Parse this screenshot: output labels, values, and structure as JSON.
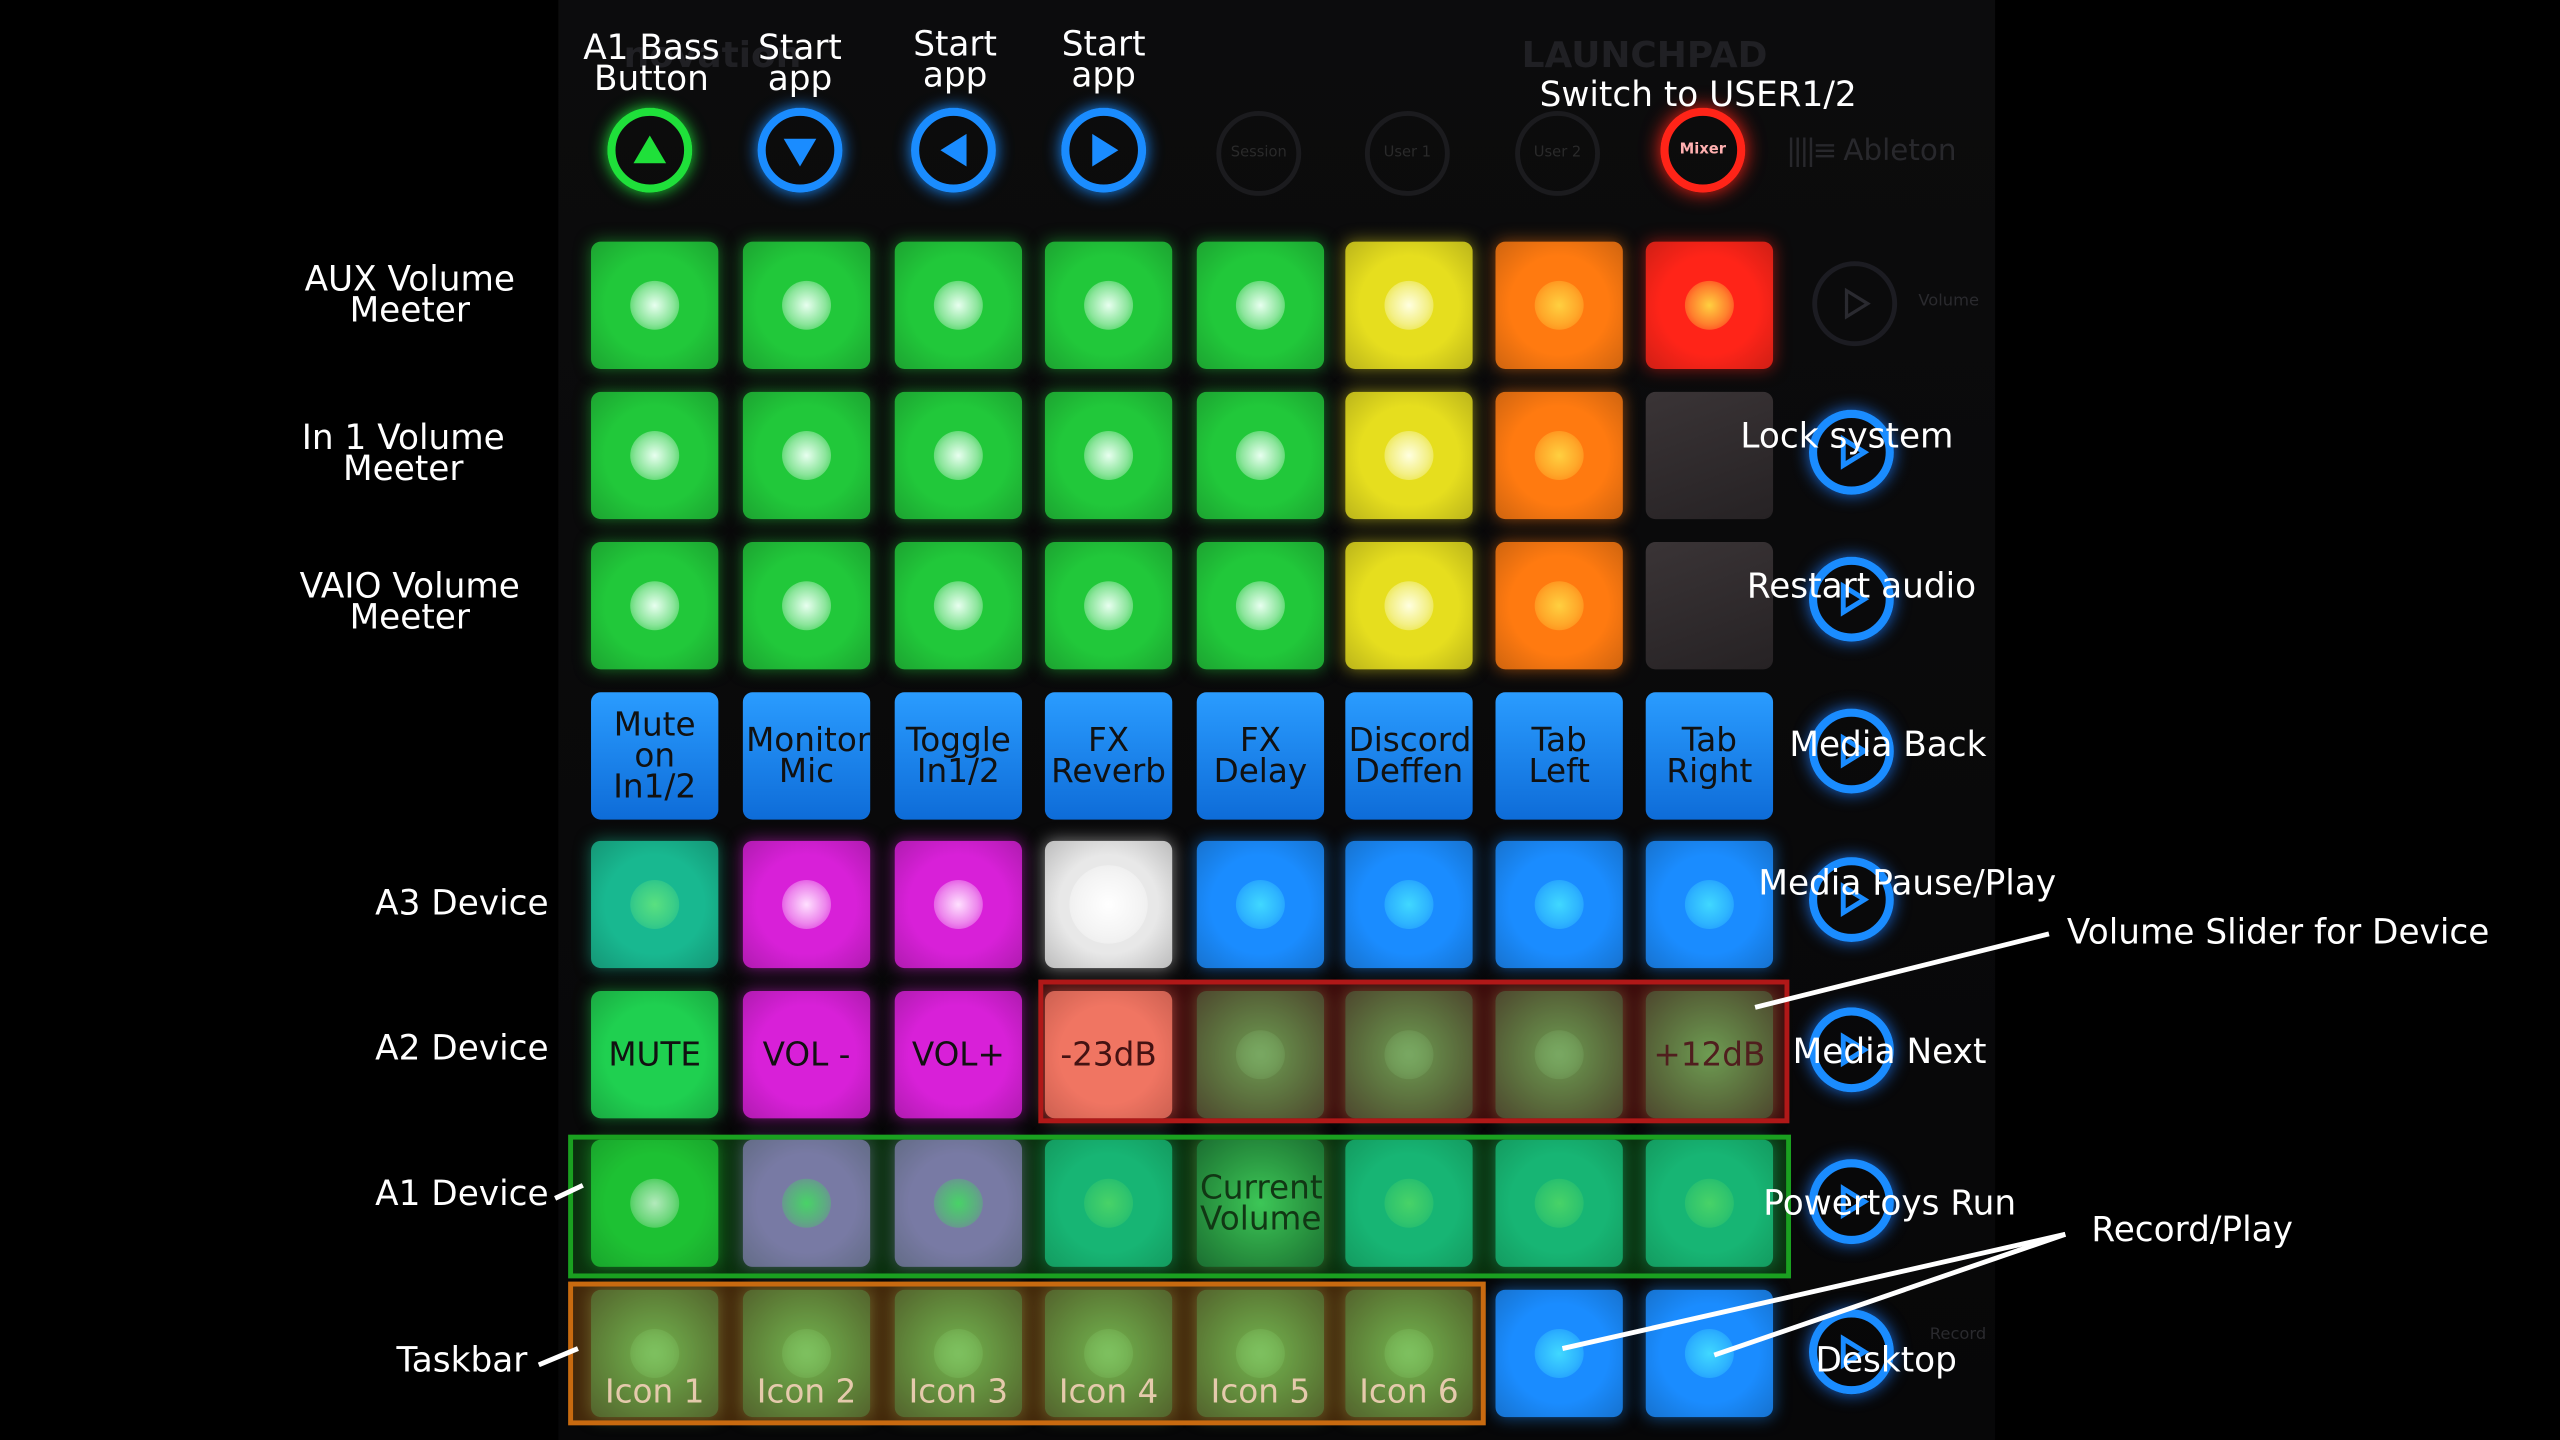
{
  "device": {
    "brand_left": "novation",
    "brand_right": "LAUNCHPAD",
    "ableton_logo": "Ableton",
    "round_labels": [
      "Session",
      "User 1",
      "User 2",
      "Mixer"
    ],
    "side_label_volume": "Volume",
    "side_label_record": "Record"
  },
  "top_labels": [
    "A1 Bass Button",
    "Start app",
    "Start app",
    "Start app"
  ],
  "switch_label": "Switch to USER1/2",
  "row_labels": [
    "AUX Volume Meeter",
    "In 1 Volume Meeter",
    "VAIO Volume Meeter",
    "A3 Device",
    "A2 Device",
    "A1 Device",
    "Taskbar"
  ],
  "right_labels": [
    "Lock system",
    "Restart audio",
    "Media Back",
    "Media Pause/Play",
    "Media Next",
    "Powertoys Run",
    "Desktop"
  ],
  "callouts": {
    "volume_slider": "Volume Slider for Device",
    "record_play": "Record/Play"
  },
  "pad_text": {
    "row4": [
      "Mute on In1/2",
      "Monitor Mic",
      "Toggle In1/2",
      "FX Reverb",
      "FX Delay",
      "Discord Deffen",
      "Tab Left",
      "Tab Right"
    ],
    "row6": [
      "MUTE",
      "VOL -",
      "VOL+",
      "-23dB",
      "",
      "",
      "",
      "+12dB"
    ],
    "row7_current": "Current Volume",
    "row8": [
      "Icon 1",
      "Icon 2",
      "Icon 3",
      "Icon 4",
      "Icon 5",
      "Icon 6",
      "",
      ""
    ]
  },
  "icons": {
    "top_buttons": [
      "up-arrow-icon",
      "down-arrow-icon",
      "left-arrow-icon",
      "right-arrow-icon"
    ],
    "side_buttons": [
      "play-icon"
    ]
  },
  "colors": {
    "green": "#22cc3a",
    "yellow": "#e8e020",
    "orange": "#ff7a10",
    "red": "#ff2418",
    "blue": "#1a8cff",
    "magenta": "#e020e0",
    "zone_red": "#b01818",
    "zone_green": "#1aa020",
    "zone_orange": "#c86a10"
  }
}
